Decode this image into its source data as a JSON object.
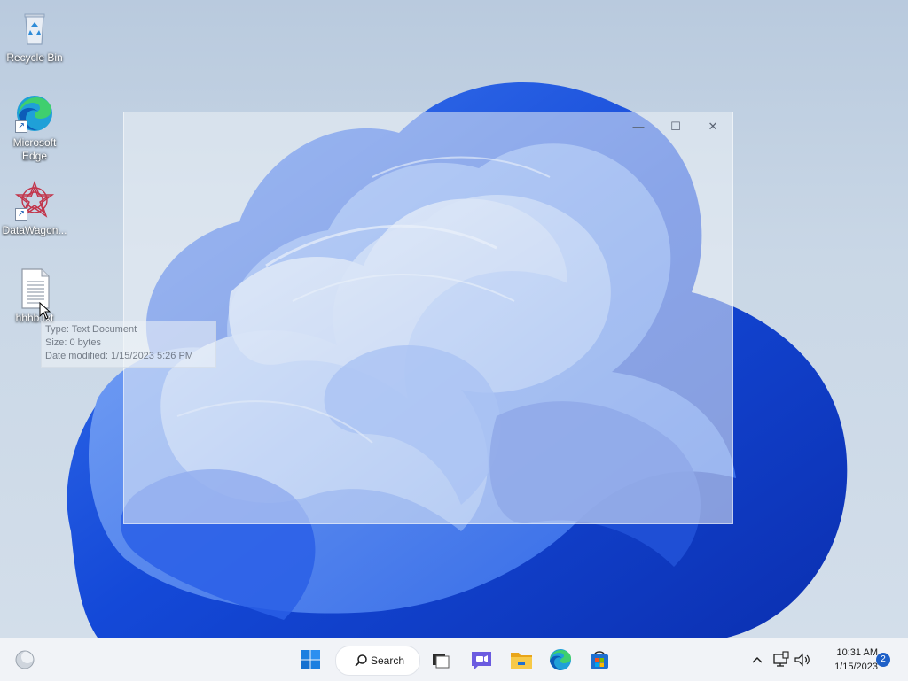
{
  "desktop": {
    "icons": [
      {
        "label": "Recycle Bin",
        "icon": "recycle-bin-icon"
      },
      {
        "label": "Microsoft Edge",
        "label_line1": "Microsoft",
        "label_line2": "Edge",
        "icon": "edge-icon",
        "shortcut": true
      },
      {
        "label": "DataWagon...",
        "icon": "datawagon-icon",
        "shortcut": true
      },
      {
        "label": "hhhb.txt",
        "icon": "text-file-icon"
      }
    ],
    "tooltip": {
      "type_line": "Type: Text Document",
      "size_line": "Size: 0 bytes",
      "date_line": "Date modified: 1/15/2023 5:26 PM"
    },
    "ghost_window": {
      "minimize_glyph": "—",
      "maximize_glyph": "☐",
      "close_glyph": "✕"
    }
  },
  "taskbar": {
    "widgets_icon": "weather-widget-icon",
    "start_icon": "windows-start-icon",
    "search_label": "Search",
    "pinned": [
      {
        "name": "task-view",
        "icon": "task-view-icon"
      },
      {
        "name": "teams-chat",
        "icon": "teams-chat-icon"
      },
      {
        "name": "file-explorer",
        "icon": "file-explorer-icon"
      },
      {
        "name": "edge",
        "icon": "edge-icon"
      },
      {
        "name": "store",
        "icon": "store-icon"
      }
    ],
    "tray": {
      "chevron_glyph": "^",
      "time": "10:31 AM",
      "date": "1/15/2023",
      "notifications": "2"
    }
  },
  "colors": {
    "accent": "#1e5fc7",
    "bloom_dark": "#0a3fd0",
    "bloom_light": "#8fb4f5"
  }
}
